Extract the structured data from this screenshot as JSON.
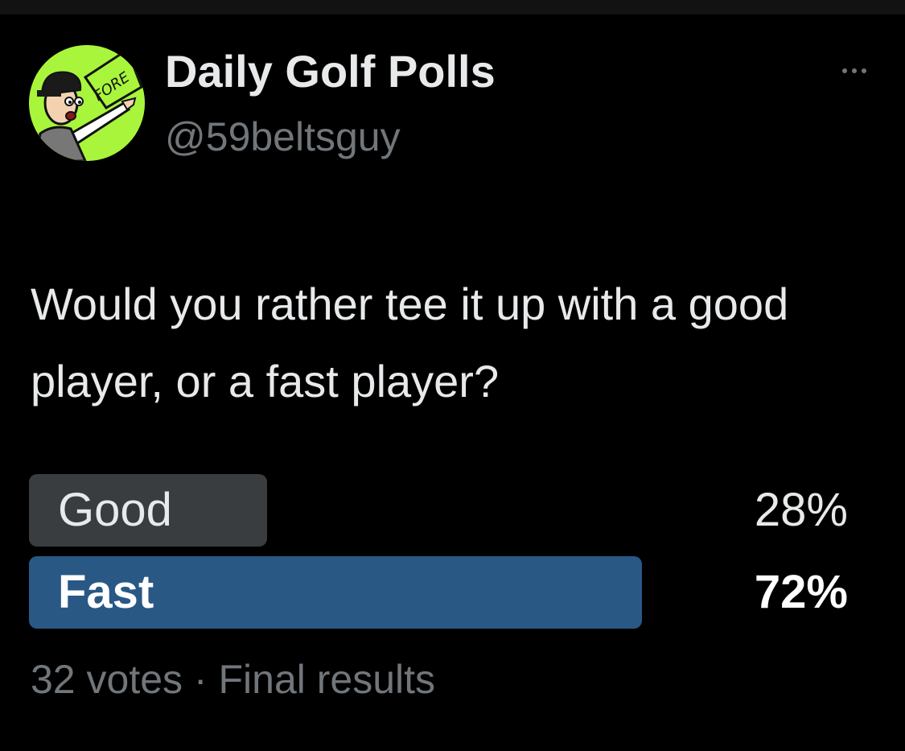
{
  "author": {
    "display_name": "Daily Golf Polls",
    "handle": "@59beltsguy",
    "avatar_icon": "cartoon-golfer-avatar",
    "avatar_text": "FORE"
  },
  "more_icon": "more-horizontal-icon",
  "tweet": {
    "text": "Would you rather tee it up with a good player, or a fast player?"
  },
  "poll": {
    "options": [
      {
        "label": "Good",
        "percent_label": "28%",
        "percent": 28,
        "winner": false,
        "bar_color": "#3a3d40"
      },
      {
        "label": "Fast",
        "percent_label": "72%",
        "percent": 72,
        "winner": true,
        "bar_color": "#295885"
      }
    ],
    "votes": "32 votes",
    "separator": "·",
    "status": "Final results"
  },
  "colors": {
    "background": "#000000",
    "text_primary": "#e7e9ea",
    "text_secondary": "#71767b",
    "avatar_bg": "#a8f53c"
  }
}
